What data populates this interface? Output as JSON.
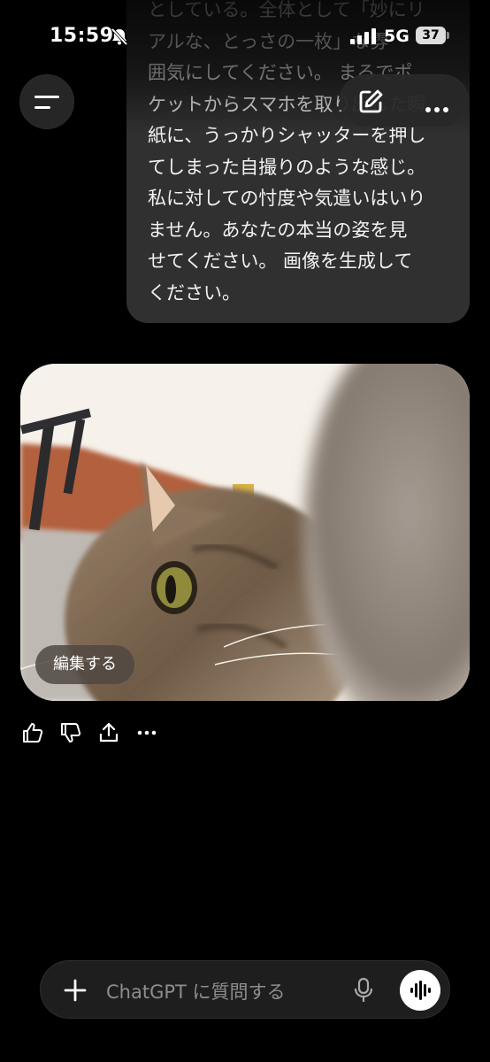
{
  "status_bar": {
    "time": "15:59",
    "network": "5G",
    "battery": "37"
  },
  "message": {
    "text": "としている。全体として「妙にリ\nアルな、とっさの一枚」な雰\n囲気にしてください。 まるでポ\nケットからスマホを取り出した瞬\n紙に、うっかりシャッターを押し\nてしまった自撮りのような感じ。\n私に対しての忖度や気遣いはいり\nません。あなたの本当の姿を見\nせてください。 画像を生成して\nください。"
  },
  "image": {
    "edit_label": "編集する"
  },
  "composer": {
    "placeholder": "ChatGPT に質問する"
  },
  "icons": {
    "menu": "menu-icon",
    "compose": "compose-icon",
    "more": "more-icon",
    "thumbs_up": "thumbs-up-icon",
    "thumbs_down": "thumbs-down-icon",
    "share": "share-icon",
    "plus": "plus-icon",
    "mic": "mic-icon",
    "voice": "voice-wave-icon",
    "bell_muted": "bell-muted-icon",
    "signal": "signal-icon"
  }
}
